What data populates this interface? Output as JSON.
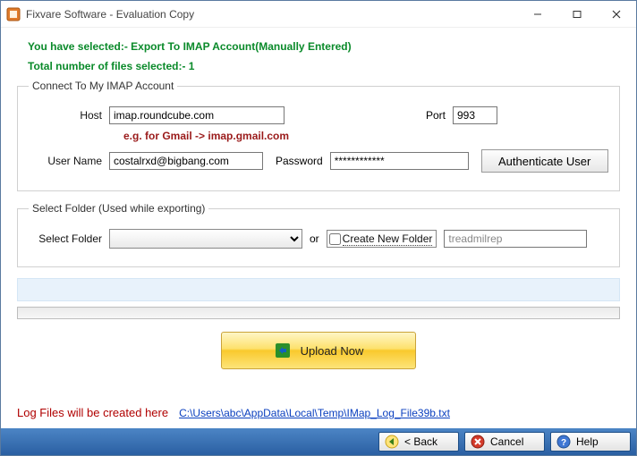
{
  "window": {
    "title": "Fixvare Software - Evaluation Copy"
  },
  "info": {
    "line1": "You have selected:- Export To IMAP Account(Manually Entered)",
    "line2": "Total number of files selected:- 1"
  },
  "imap_group": {
    "legend": "Connect To My IMAP Account",
    "host_label": "Host",
    "host_value": "imap.roundcube.com",
    "port_label": "Port",
    "port_value": "993",
    "hint": "e.g. for Gmail -> imap.gmail.com",
    "user_label": "User Name",
    "user_value": "costalrxd@bigbang.com",
    "password_label": "Password",
    "password_value": "************",
    "auth_button": "Authenticate User"
  },
  "folder_group": {
    "legend": "Select Folder (Used while exporting)",
    "select_label": "Select Folder",
    "or_label": "or",
    "create_new_label": "Create New Folder",
    "new_folder_value": "treadmilrep"
  },
  "upload_button": "Upload Now",
  "log": {
    "label": "Log Files will be created here",
    "path": "C:\\Users\\abc\\AppData\\Local\\Temp\\IMap_Log_File39b.txt"
  },
  "footer": {
    "back": "< Back",
    "cancel": "Cancel",
    "help": "Help"
  }
}
